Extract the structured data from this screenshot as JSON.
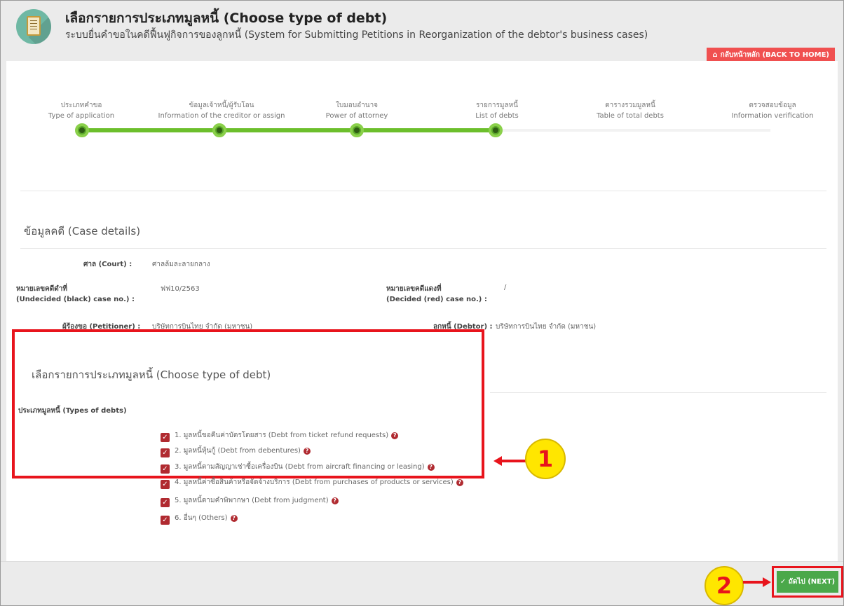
{
  "header": {
    "title": "เลือกรายการประเภทมูลหนี้ (Choose type of debt)",
    "subtitle": "ระบบยื่นคำขอในคดีฟื้นฟูกิจการของลูกหนี้ (System for Submitting Petitions in Reorganization of the debtor's business cases)",
    "home_button": "กลับหน้าหลัก (BACK TO HOME)",
    "home_icon": "home-icon"
  },
  "wizard": {
    "steps": [
      {
        "th": "ประเภทคำขอ",
        "en": "Type of application"
      },
      {
        "th": "ข้อมูลเจ้าหนี้/ผู้รับโอน",
        "en": "Information of the creditor or assign"
      },
      {
        "th": "ใบมอบอำนาจ",
        "en": "Power of attorney"
      },
      {
        "th": "รายการมูลหนี้",
        "en": "List of debts"
      },
      {
        "th": "ตารางรวมมูลหนี้",
        "en": "Table of total debts"
      },
      {
        "th": "ตรวจสอบข้อมูล",
        "en": "Information verification"
      }
    ],
    "completed_steps": 4,
    "colors": {
      "done": "#6cbf2c",
      "dot": "#5aa62a"
    }
  },
  "case_details": {
    "section_title": "ข้อมูลคดี (Case details)",
    "court_label": "ศาล (Court) :",
    "court_value": "ศาลล้มละลายกลาง",
    "black_case_label_th": "หมายเลขคดีดำที่",
    "black_case_label_en": "(Undecided (black) case no.) :",
    "black_case_value": "ฟฟ10/2563",
    "red_case_label_th": "หมายเลขคดีแดงที่",
    "red_case_label_en": "(Decided (red) case no.) :",
    "red_case_value": "/",
    "petitioner_label": "ผู้ร้องขอ (Petitioner) :",
    "petitioner_value": "บริษัทการบินไทย จำกัด (มหาชน)",
    "debtor_label": "ลูกหนี้ (Debtor) :",
    "debtor_value": "บริษัทการบินไทย จำกัด (มหาชน)"
  },
  "debt_types": {
    "section_title": "เลือกรายการประเภทมูลหนี้ (Choose type of debt)",
    "label": "ประเภทมูลหนี้ (Types of debts)",
    "items": [
      {
        "label": "1. มูลหนี้ขอคืนค่าบัตรโดยสาร (Debt from ticket refund requests)",
        "checked": true
      },
      {
        "label": "2. มูลหนี้หุ้นกู้ (Debt from debentures)",
        "checked": true
      },
      {
        "label": "3. มูลหนี้ตามสัญญาเช่าซื้อเครื่องบิน (Debt from aircraft financing or leasing)",
        "checked": true
      },
      {
        "label": "4. มูลหนี้ค่าซื้อสินค้าหรือจัดจ้างบริการ (Debt from purchases of products or services)",
        "checked": true
      },
      {
        "label": "5. มูลหนี้ตามคำพิพากษา (Debt from judgment)",
        "checked": true
      },
      {
        "label": "6. อื่นๆ (Others)",
        "checked": true
      }
    ],
    "checkbox_color": "#b02a30"
  },
  "annotations": {
    "callout_1": "1",
    "callout_2": "2",
    "highlight_color": "#e8141c",
    "callout_color": "#ffe600"
  },
  "footer": {
    "next_button": "ถัดไป (NEXT)",
    "next_icon": "check-icon",
    "next_color": "#4ba84a"
  }
}
